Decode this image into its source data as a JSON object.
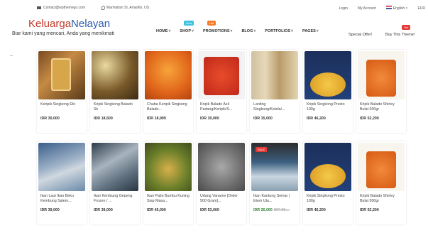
{
  "topbar": {
    "email": "Contact@wpthemego.com",
    "address": "Manhattan St, Amarillo, US",
    "login": "Login",
    "my_account": "My Account",
    "language": "English",
    "currency": "EUR"
  },
  "brand": {
    "name_part1": "Keluarga",
    "name_part2": "Nelayan",
    "tagline": "Biar kami yang mencari, Anda yang menikmati"
  },
  "nav": {
    "items": [
      {
        "label": "HOME",
        "badge": ""
      },
      {
        "label": "SHOP",
        "badge": "New"
      },
      {
        "label": "PROMOTIONS",
        "badge": "Hot"
      },
      {
        "label": "BLOG",
        "badge": ""
      },
      {
        "label": "PORTFOLIOS",
        "badge": ""
      },
      {
        "label": "PAGES",
        "badge": ""
      }
    ],
    "special_offer": "Special Offer!",
    "buy_theme": "Buy This Theme!",
    "buy_theme_badge": "Hot"
  },
  "products": [
    [
      {
        "name": "Keripik Singkong Ebi",
        "price": "IDR 30,000"
      },
      {
        "name": "Kripik Singkong Balado Sk",
        "price": "IDR 18,500"
      },
      {
        "name": "Chuba Keripik Singkong Balado...",
        "price": "IDR 18,999"
      },
      {
        "name": "Kripik Balado Asli Padang/Keripik/S...",
        "price": "IDR 30,000"
      },
      {
        "name": "Lanting Singkong/Ketela/...",
        "price": "IDR 15,000"
      },
      {
        "name": "Kripik Singkong Presto 100g",
        "price": "IDR 46,200"
      },
      {
        "name": "Kripik Balado Shirley Bulat 500gr",
        "price": "IDR 52,200"
      }
    ],
    [
      {
        "name": "Ikan Laut Ikan Beku Kembung Salem...",
        "price": "IDR 39,000"
      },
      {
        "name": "Ikan Kembung Gepeng Frozen / ...",
        "price": "IDR 39,000"
      },
      {
        "name": "Ikan Patin Bumbu Kuning Siap Masa...",
        "price": "IDR 45,000"
      },
      {
        "name": "Udang Vaname [Order 500 Gram]...",
        "price": "IDR 53,000"
      },
      {
        "name": "Ikan Kantung Semar | Etem Utu...",
        "price": "IDR 26,000",
        "old_price": "IDR 29,...",
        "badge": "SALE"
      },
      {
        "name": "Kripik Singkong Presto 100g",
        "price": "IDR 46,200"
      },
      {
        "name": "Kripik Balado Shirley Bulat 500gr",
        "price": "IDR 52,200"
      }
    ]
  ]
}
